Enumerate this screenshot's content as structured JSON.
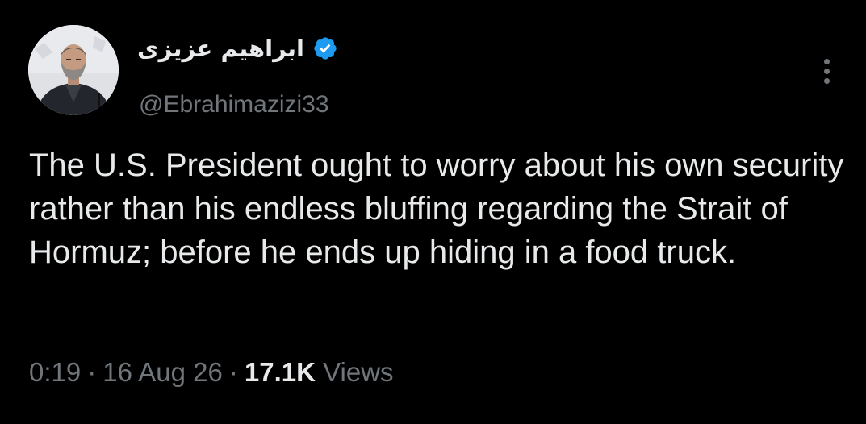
{
  "author": {
    "display_name": "ابراهیم عزیزی",
    "handle": "@Ebrahimazizi33",
    "verified": true,
    "avatar_icon": "profile-photo",
    "verified_color": "#1d9bf0"
  },
  "tweet": {
    "text": "The U.S. President ought to worry about his own security rather than his endless bluffing regarding the Strait of Hormuz; before he ends up hiding in a food truck."
  },
  "meta": {
    "time": "0:19",
    "separator": "·",
    "date": "16 Aug 26",
    "views_count": "17.1K",
    "views_label": "Views"
  },
  "menu": {
    "more_icon": "more-vertical-icon"
  },
  "colors": {
    "background": "#000000",
    "primary_text": "#e7e9ea",
    "secondary_text": "#71767b"
  }
}
